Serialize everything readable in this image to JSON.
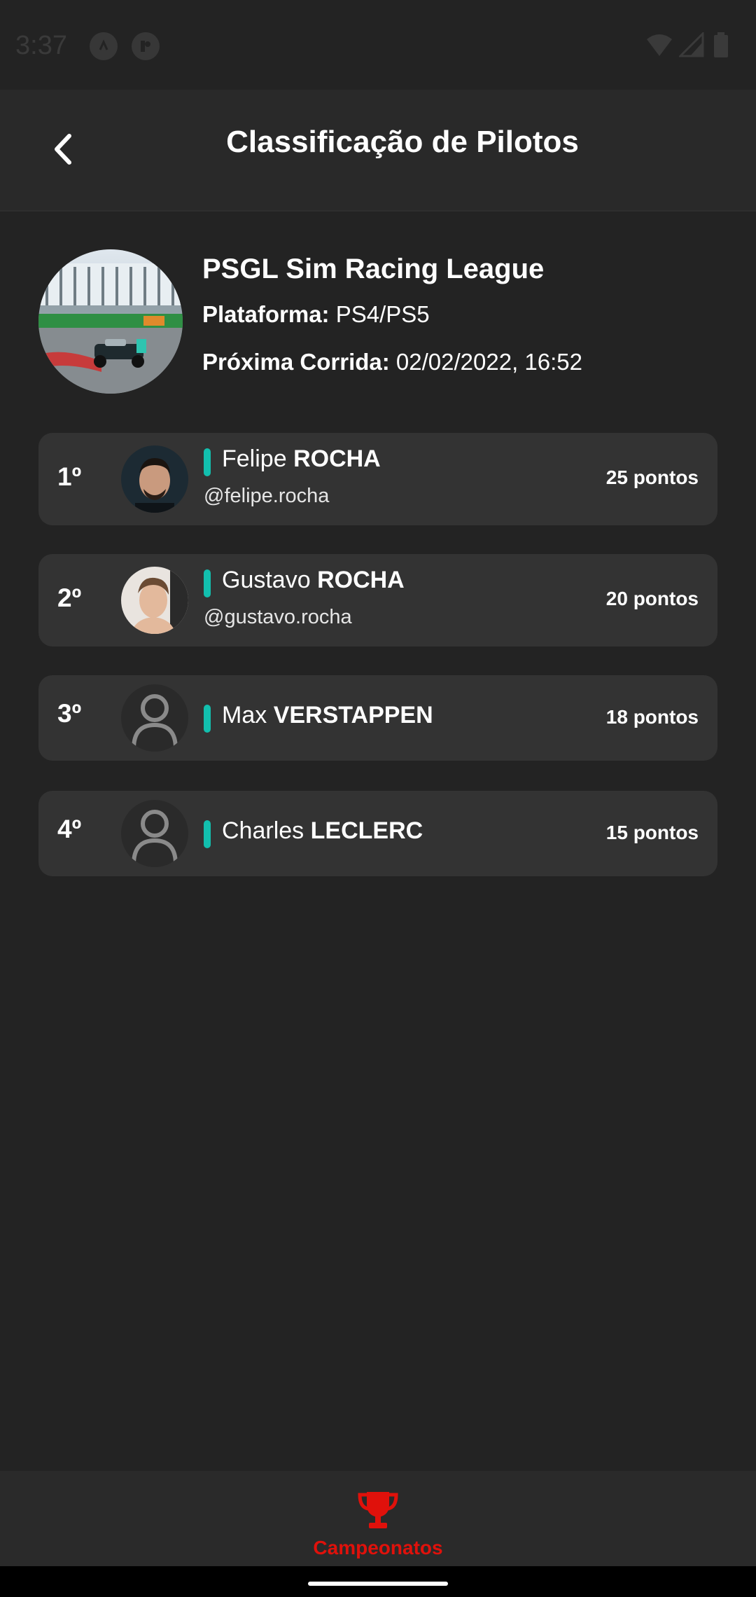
{
  "status_bar": {
    "time": "3:37"
  },
  "header": {
    "title": "Classificação de Pilotos"
  },
  "league": {
    "name": "PSGL Sim Racing League",
    "platform_label": "Plataforma:",
    "platform_value": "PS4/PS5",
    "next_race_label": "Próxima Corrida:",
    "next_race_value": "02/02/2022, 16:52"
  },
  "drivers": [
    {
      "position": "1º",
      "first_name": "Felipe",
      "last_name": "ROCHA",
      "handle": "@felipe.rocha",
      "points": "25 pontos",
      "avatar": "photo",
      "team_color": "#12bfae"
    },
    {
      "position": "2º",
      "first_name": "Gustavo",
      "last_name": "ROCHA",
      "handle": "@gustavo.rocha",
      "points": "20 pontos",
      "avatar": "photo",
      "team_color": "#12bfae"
    },
    {
      "position": "3º",
      "first_name": "Max",
      "last_name": "VERSTAPPEN",
      "points": "18 pontos",
      "avatar": "user-placeholder-icon",
      "team_color": "#12bfae"
    },
    {
      "position": "4º",
      "first_name": "Charles",
      "last_name": "LECLERC",
      "points": "15 pontos",
      "avatar": "user-placeholder-icon",
      "team_color": "#12bfae"
    }
  ],
  "bottom_nav": {
    "items": [
      {
        "label": "Campeonatos",
        "icon": "trophy-icon",
        "active": true
      }
    ]
  },
  "colors": {
    "background": "#232323",
    "card": "#333333",
    "accent": "#e0110b",
    "team": "#12bfae"
  }
}
